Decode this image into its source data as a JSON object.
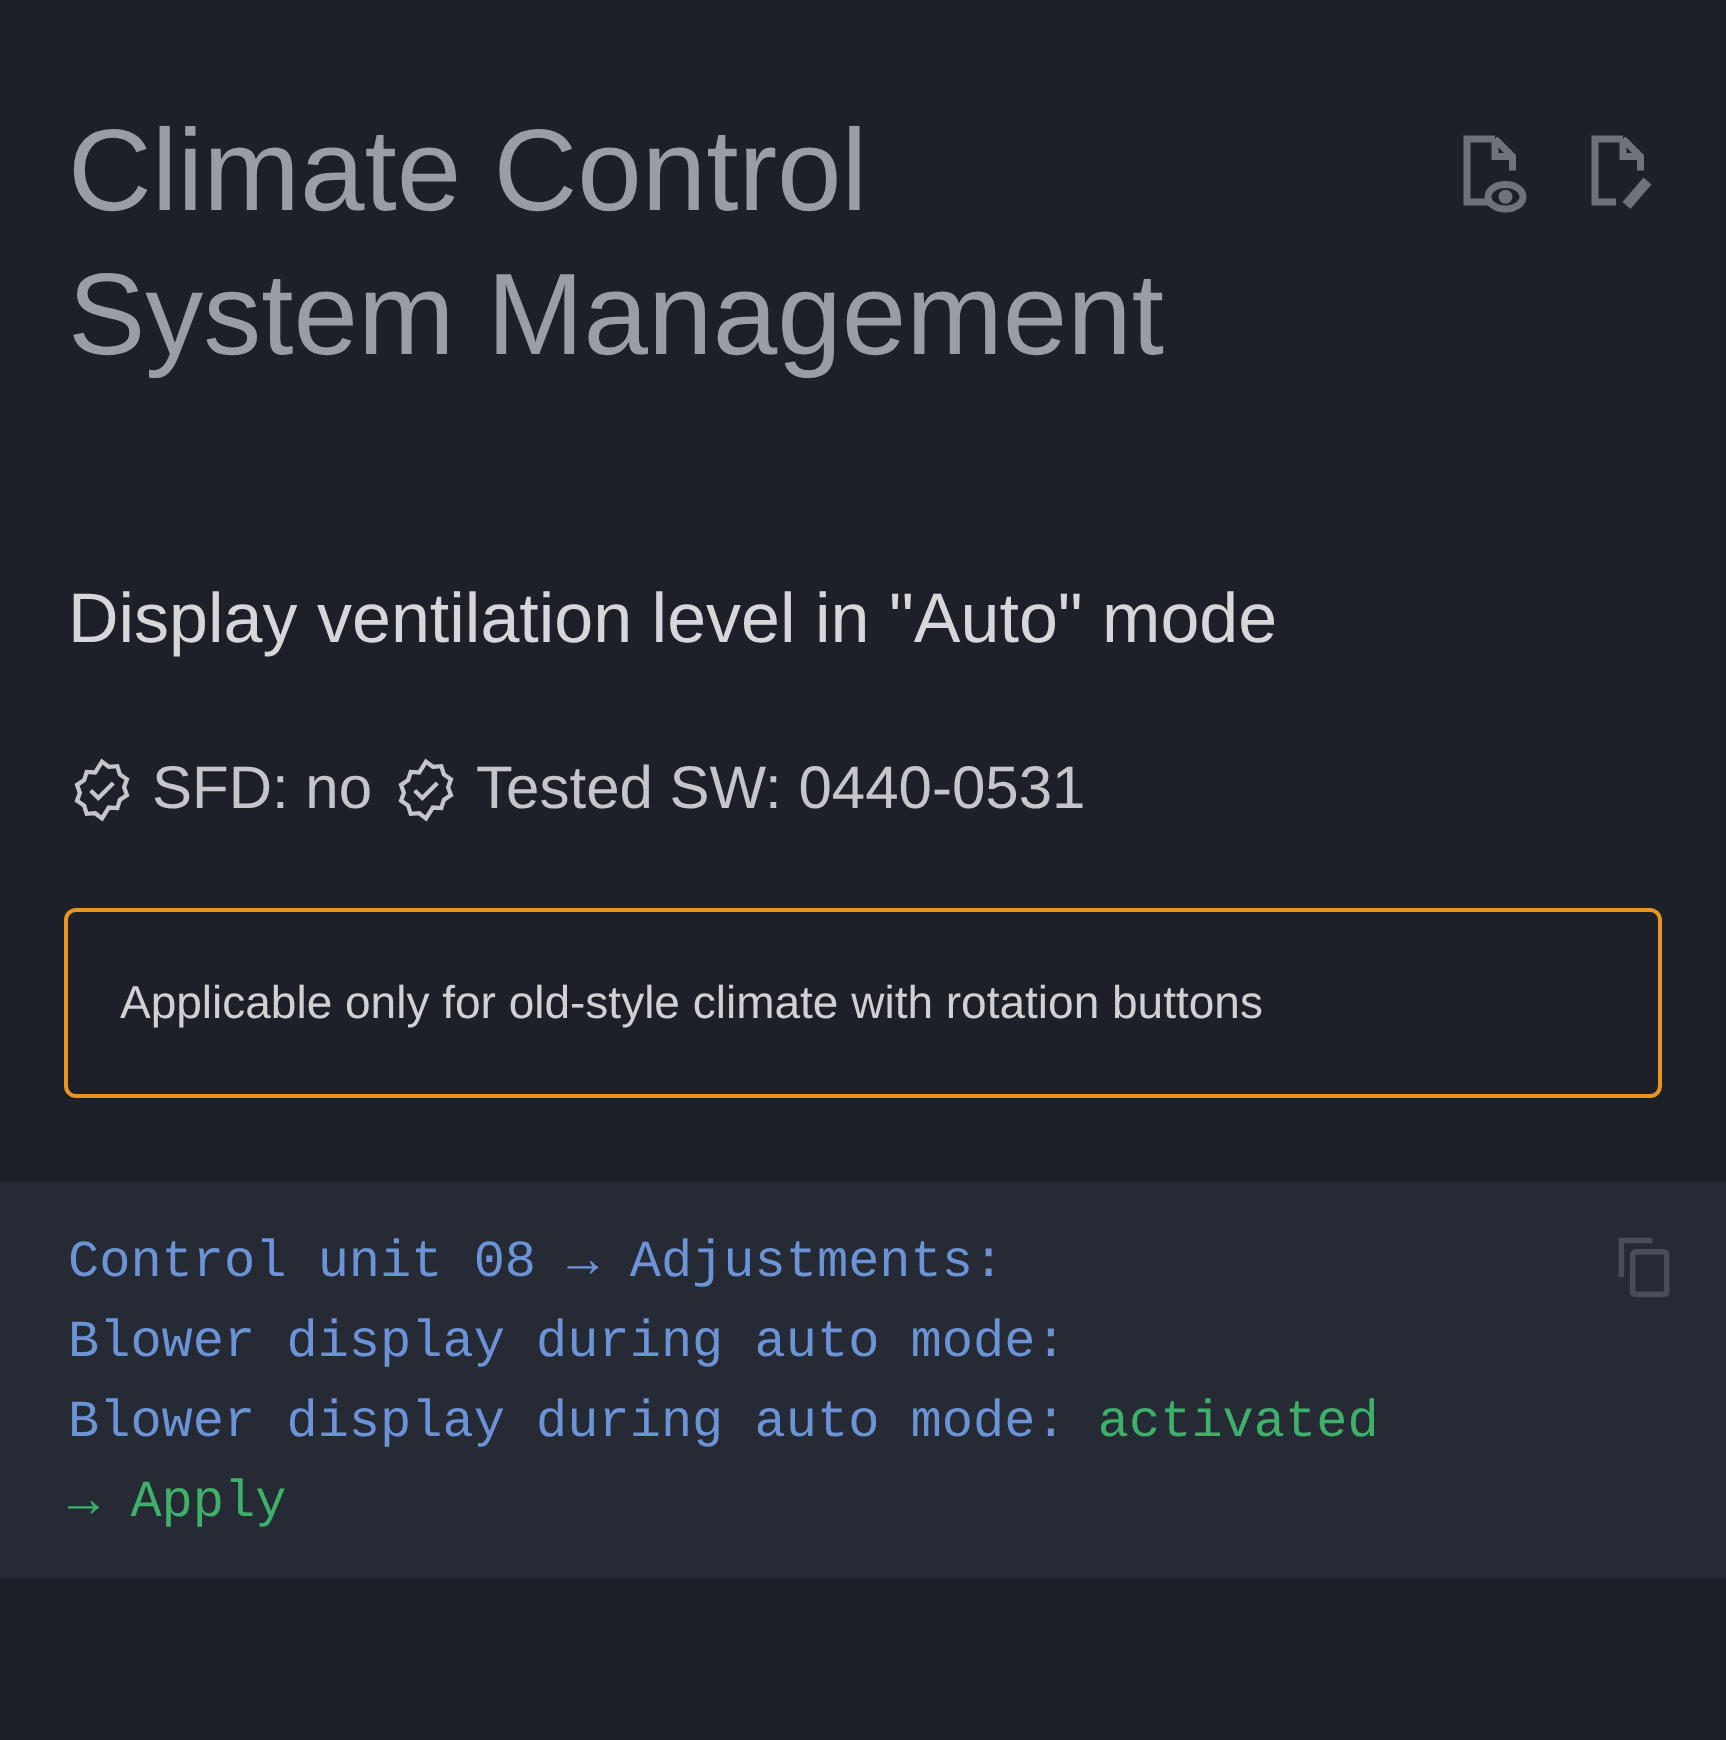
{
  "title": "Climate Control System Management",
  "header_actions": [
    {
      "kind": "view"
    },
    {
      "kind": "edit"
    }
  ],
  "heading": "Display ventilation level in \"Auto\" mode",
  "badges": [
    {
      "label": "SFD: no"
    },
    {
      "label": "Tested SW: 0440-0531"
    }
  ],
  "notice": "Applicable only for old-style climate with rotation buttons",
  "code_lines": [
    [
      {
        "kind": "path",
        "text": "Control unit 08 → Adjustments:"
      }
    ],
    [
      {
        "kind": "path",
        "text": "Blower display during auto mode:"
      }
    ],
    [
      {
        "kind": "path",
        "text": "Blower display during auto mode: "
      },
      {
        "kind": "value",
        "text": "activated"
      }
    ],
    [
      {
        "kind": "value",
        "text": "→ Apply"
      }
    ]
  ]
}
